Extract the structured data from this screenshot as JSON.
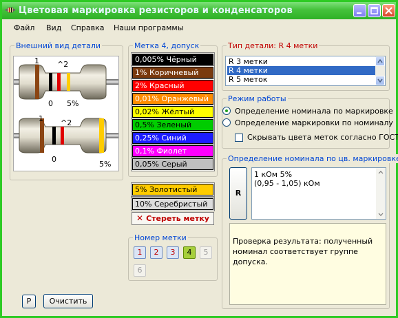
{
  "window": {
    "title": "Цветовая маркировка резисторов и конденсаторов"
  },
  "menu": [
    "Файл",
    "Вид",
    "Справка",
    "Наши программы"
  ],
  "appearance": {
    "title": "Внешний вид детали",
    "top_labels": {
      "first": "1",
      "mult": "^2",
      "zero": "0",
      "tol": "5%"
    },
    "bottom_labels": {
      "first": "1",
      "mult": "^2",
      "zero": "0",
      "tol": "5%"
    }
  },
  "mark4": {
    "title": "Метка 4, допуск",
    "colors": [
      {
        "label": "0,005% Чёрный",
        "bg": "#000000",
        "fg": "#ffffff"
      },
      {
        "label": "1% Коричневый",
        "bg": "#7a3a0e",
        "fg": "#ffffff"
      },
      {
        "label": "2% Красный",
        "bg": "#ff0000",
        "fg": "#ffffff"
      },
      {
        "label": "0,01% Оранжевый",
        "bg": "#ff8c00",
        "fg": "#ffffff"
      },
      {
        "label": "0,02% Жёлтый",
        "bg": "#ffff00",
        "fg": "#000000"
      },
      {
        "label": "0,5% Зеленый",
        "bg": "#00cc00",
        "fg": "#000000"
      },
      {
        "label": "0,25% Синий",
        "bg": "#1c1cff",
        "fg": "#ffffff"
      },
      {
        "label": "0,1% Фиолет",
        "bg": "#ff00ff",
        "fg": "#ffffff"
      },
      {
        "label": "0,05% Серый",
        "bg": "#c0c0c0",
        "fg": "#000000"
      }
    ],
    "gold": {
      "label": "5% Золотистый",
      "bg": "#ffcc00",
      "fg": "#000000"
    },
    "silver": {
      "label": "10% Серебристый",
      "bg": "#dcdcdc",
      "fg": "#000000"
    },
    "erase_label": "Стереть метку"
  },
  "mark_number": {
    "title": "Номер метки",
    "buttons": [
      "1",
      "2",
      "3",
      "4",
      "5",
      "6"
    ]
  },
  "part_type": {
    "title_prefix": "Тип детали:",
    "title_value": "R 4 метки",
    "options": [
      "R 3 метки",
      "R 4 метки",
      "R 5 меток"
    ],
    "selected_index": 1
  },
  "mode": {
    "title": "Режим работы",
    "options": [
      "Определение номинала по маркировке",
      "Определение маркировки по номиналу"
    ],
    "selected_index": 0,
    "hide_colors_label": "Скрывать цвета меток согласно ГОСТ"
  },
  "result": {
    "title": "Определение номинала по цв. маркировке",
    "button_label": "R",
    "line1": "1 кОм 5%",
    "line2": "(0,95 - 1,05) кОм",
    "note": "Проверка результата: полученный номинал соответствует группе допуска."
  },
  "bottom_buttons": {
    "p_label": "P",
    "clear_label": "Очистить"
  }
}
